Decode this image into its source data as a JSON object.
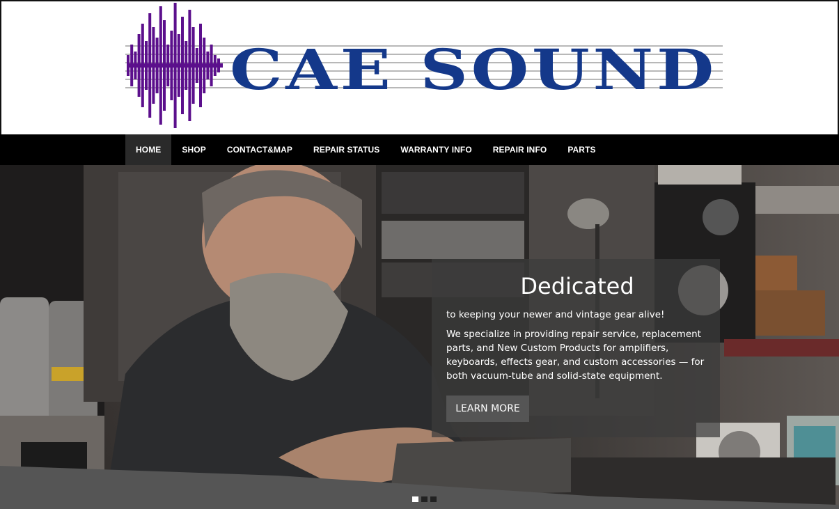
{
  "site": {
    "logo_text": "CAE SOUND",
    "logo_wave_color": "#5b0f8c",
    "logo_text_color": "#14388a"
  },
  "nav": {
    "items": [
      {
        "label": "HOME",
        "active": true
      },
      {
        "label": "SHOP"
      },
      {
        "label": "CONTACT&MAP"
      },
      {
        "label": "REPAIR STATUS"
      },
      {
        "label": "WARRANTY INFO"
      },
      {
        "label": "REPAIR INFO"
      },
      {
        "label": "PARTS"
      }
    ]
  },
  "hero": {
    "title": "Dedicated",
    "subtitle": "to keeping your newer and vintage gear alive!",
    "body": "We specialize in providing repair service, replacement parts, and New Custom Products for amplifiers, keyboards, effects gear, and custom accessories — for both vacuum-tube and solid-state equipment.",
    "button_label": "LEARN MORE",
    "slides": 3,
    "active_slide": 1
  }
}
